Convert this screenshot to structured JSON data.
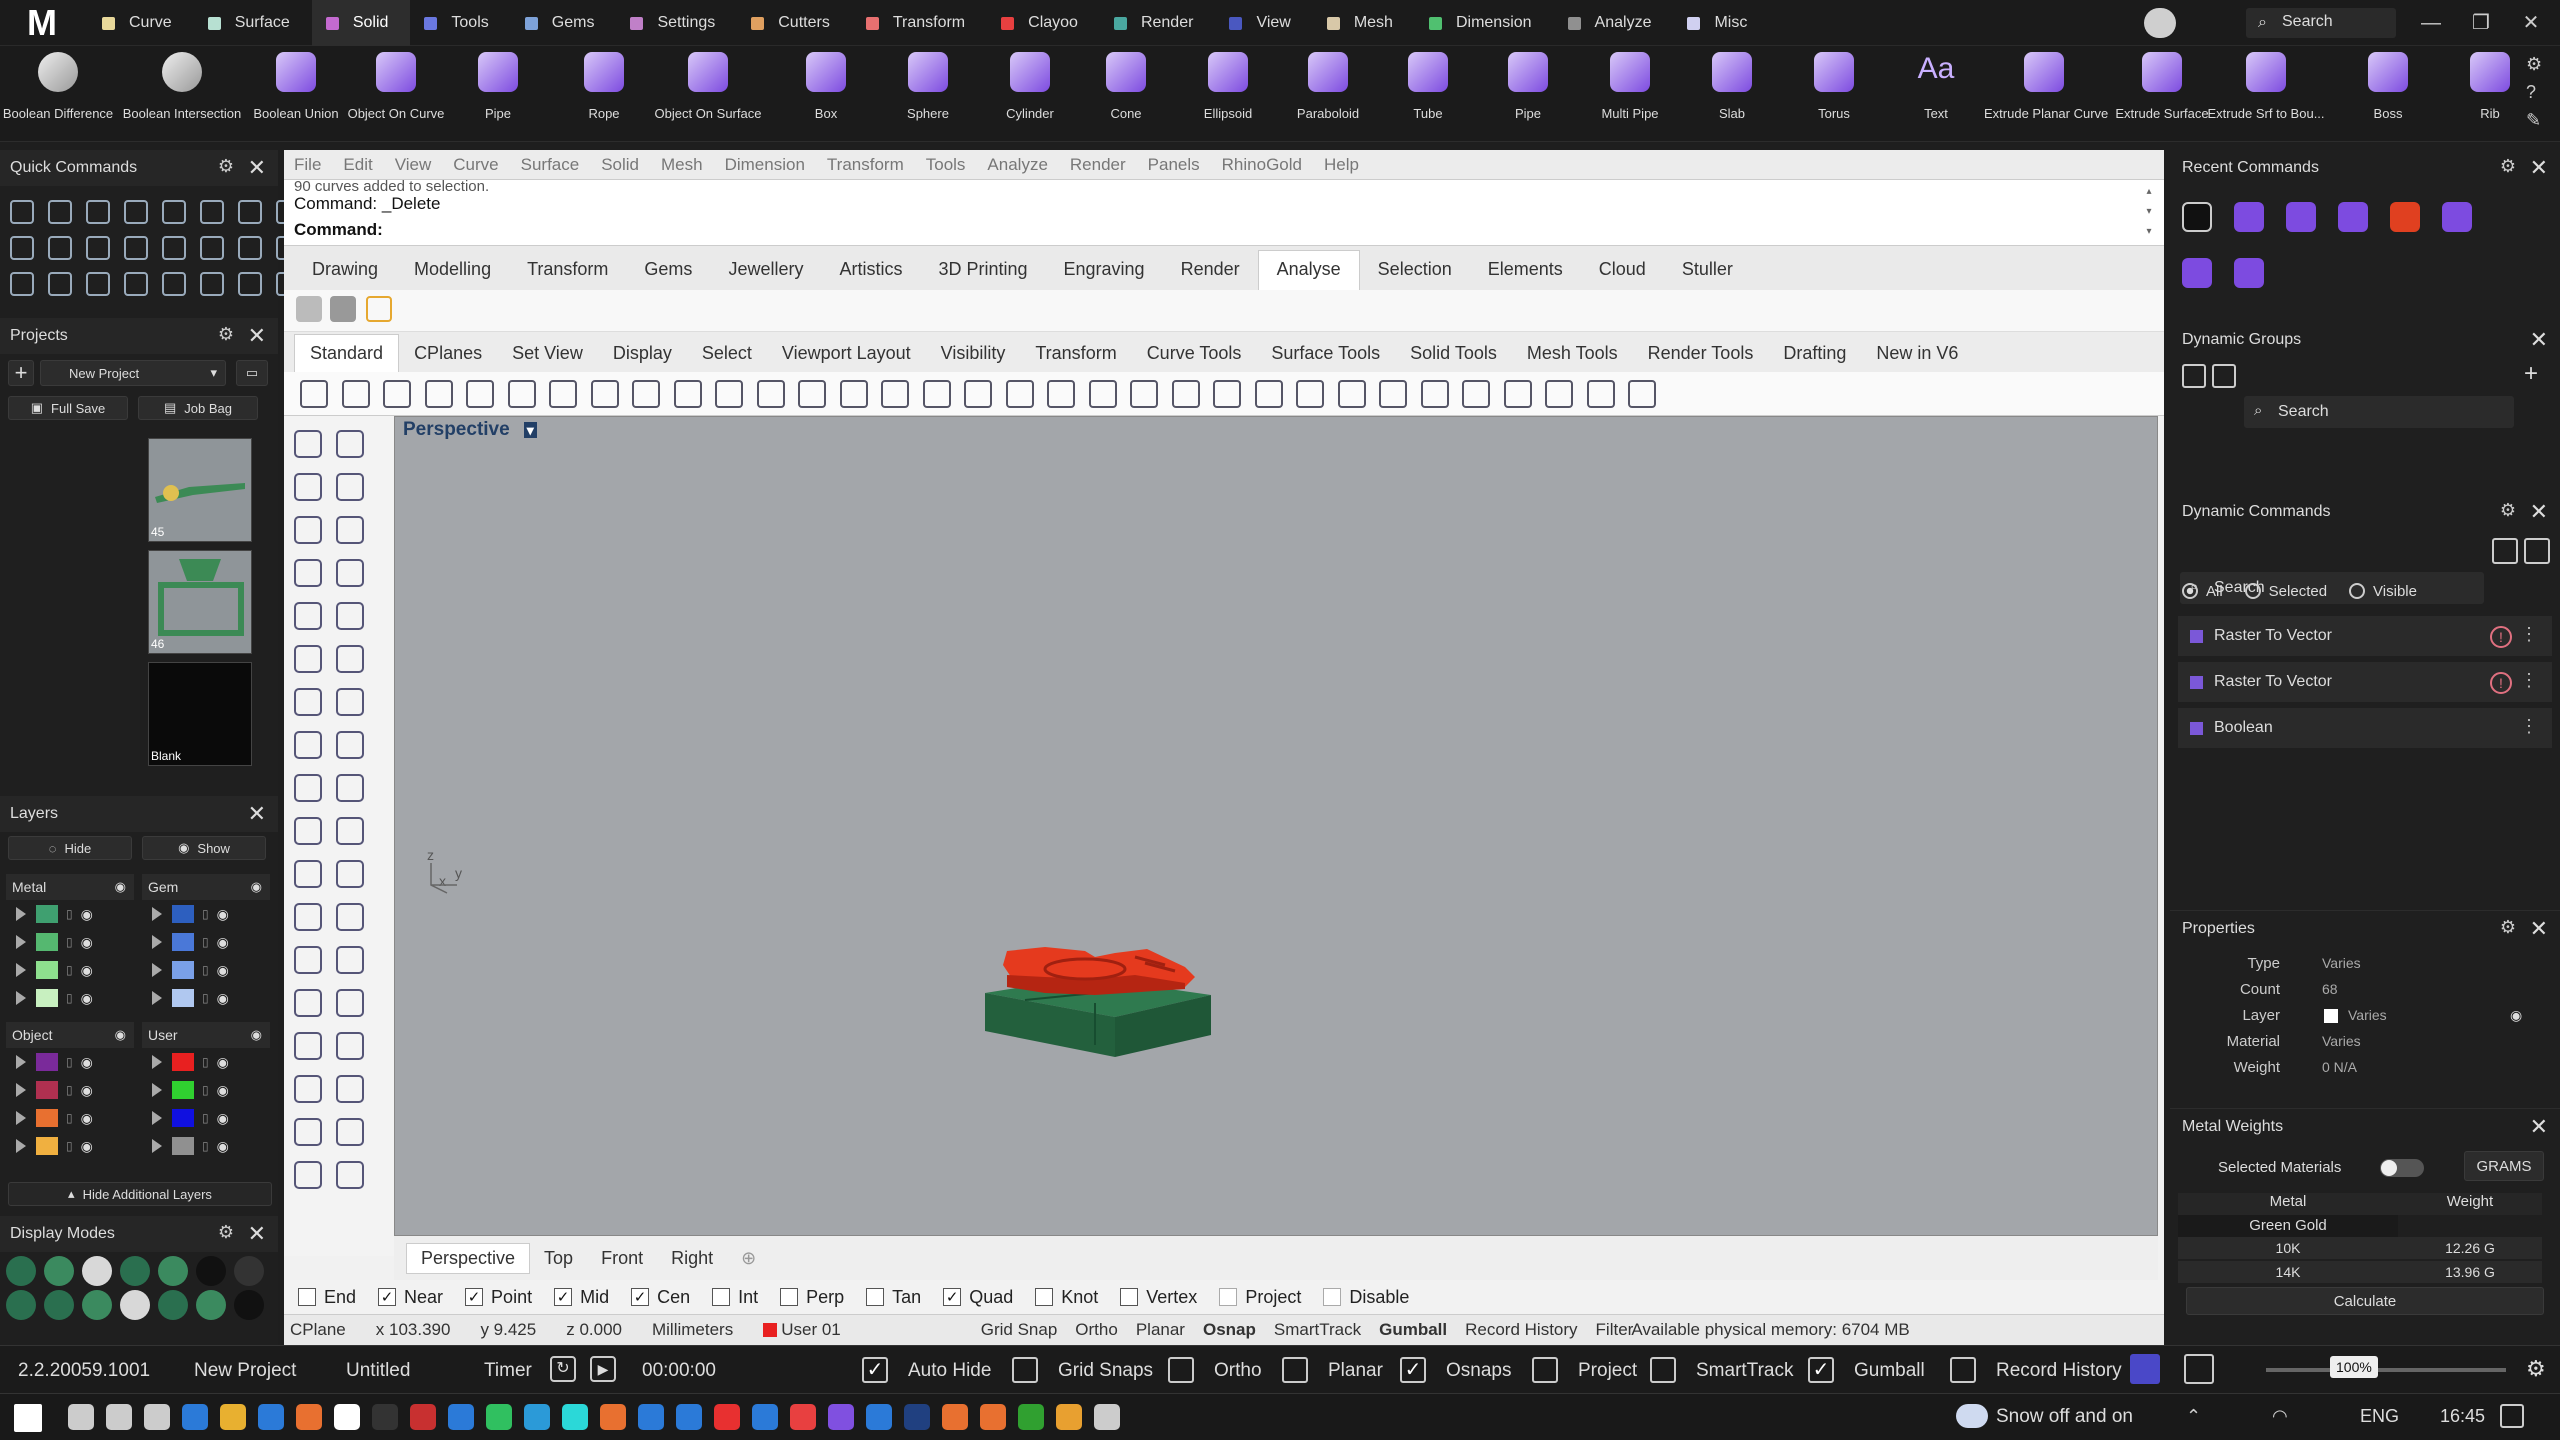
{
  "app": {
    "logo": "M"
  },
  "menu_tabs": [
    {
      "label": "Curve",
      "color": "#e8d89a"
    },
    {
      "label": "Surface",
      "color": "#b7e0d2"
    },
    {
      "label": "Solid",
      "color": "#c46ad0"
    },
    {
      "label": "Tools",
      "color": "#6a78e0"
    },
    {
      "label": "Gems",
      "color": "#7ea2d8"
    },
    {
      "label": "Settings",
      "color": "#c080c8"
    },
    {
      "label": "Cutters",
      "color": "#e0a060"
    },
    {
      "label": "Transform",
      "color": "#e87070"
    },
    {
      "label": "Clayoo",
      "color": "#e84040"
    },
    {
      "label": "Render",
      "color": "#4aa8a0"
    },
    {
      "label": "View",
      "color": "#4a58c0"
    },
    {
      "label": "Mesh",
      "color": "#d8c8a8"
    },
    {
      "label": "Dimension",
      "color": "#50c070"
    },
    {
      "label": "Analyze",
      "color": "#909090"
    },
    {
      "label": "Misc",
      "color": "#d0d0f0"
    }
  ],
  "top_search": {
    "label": "Search"
  },
  "ribbon_tools": [
    "Boolean Difference",
    "Boolean Intersection",
    "Boolean Union",
    "Object On Curve",
    "Pipe",
    "Rope",
    "Object On Surface",
    "Box",
    "Sphere",
    "Cylinder",
    "Cone",
    "Ellipsoid",
    "Paraboloid",
    "Tube",
    "Pipe",
    "Multi Pipe",
    "Slab",
    "Torus",
    "Text",
    "Extrude Planar Curve",
    "Extrude Surface",
    "Extrude Srf to Bou...",
    "Boss",
    "Rib"
  ],
  "text_tool_glyph": "Aa",
  "quick_commands": {
    "title": "Quick Commands"
  },
  "projects": {
    "title": "Projects",
    "project_name": "New Project",
    "full_save": "Full Save",
    "job_bag": "Job Bag",
    "thumbs": [
      {
        "label": "45"
      },
      {
        "label": "46"
      },
      {
        "label": "Blank"
      }
    ]
  },
  "layers": {
    "title": "Layers",
    "hide": "Hide",
    "show": "Show",
    "groups": [
      {
        "name": "Metal",
        "colors": [
          "#3fa070",
          "#55b870",
          "#8ee08e",
          "#c8f0c0"
        ]
      },
      {
        "name": "Gem",
        "colors": [
          "#2d5fbf",
          "#4a78d8",
          "#7aa0e8",
          "#b0c8f0"
        ]
      },
      {
        "name": "Object",
        "colors": [
          "#7a2a9a",
          "#b03050",
          "#e87030",
          "#f0b040"
        ]
      },
      {
        "name": "User",
        "colors": [
          "#e82020",
          "#30d030",
          "#1010e0",
          "#909090"
        ]
      }
    ],
    "hide_additional": "Hide Additional Layers"
  },
  "display_modes": {
    "title": "Display Modes"
  },
  "main_menu": [
    "File",
    "Edit",
    "View",
    "Curve",
    "Surface",
    "Solid",
    "Mesh",
    "Dimension",
    "Transform",
    "Tools",
    "Analyze",
    "Render",
    "Panels",
    "RhinoGold",
    "Help"
  ],
  "command_history": {
    "line1": "90 curves added to selection.",
    "line2": "Command: _Delete",
    "prompt": "Command:"
  },
  "tabs1": [
    "Drawing",
    "Modelling",
    "Transform",
    "Gems",
    "Jewellery",
    "Artistics",
    "3D Printing",
    "Engraving",
    "Render",
    "Analyse",
    "Selection",
    "Elements",
    "Cloud",
    "Stuller"
  ],
  "tabs1_active": "Analyse",
  "tabs2": [
    "Standard",
    "CPlanes",
    "Set View",
    "Display",
    "Select",
    "Viewport Layout",
    "Visibility",
    "Transform",
    "Curve Tools",
    "Surface Tools",
    "Solid Tools",
    "Mesh Tools",
    "Render Tools",
    "Drafting",
    "New in V6"
  ],
  "tabs2_active": "Standard",
  "viewport": {
    "title": "Perspective",
    "axis_z": "z",
    "axis_x": "x",
    "axis_y": "y"
  },
  "viewport_tabs": [
    "Perspective",
    "Top",
    "Front",
    "Right"
  ],
  "osnaps": [
    {
      "label": "End",
      "checked": false
    },
    {
      "label": "Near",
      "checked": true
    },
    {
      "label": "Point",
      "checked": true
    },
    {
      "label": "Mid",
      "checked": true
    },
    {
      "label": "Cen",
      "checked": true
    },
    {
      "label": "Int",
      "checked": false
    },
    {
      "label": "Perp",
      "checked": false
    },
    {
      "label": "Tan",
      "checked": false
    },
    {
      "label": "Quad",
      "checked": true
    },
    {
      "label": "Knot",
      "checked": false
    },
    {
      "label": "Vertex",
      "checked": false
    },
    {
      "label": "Project",
      "checked": false
    },
    {
      "label": "Disable",
      "checked": false
    }
  ],
  "coords": {
    "cplane": "CPlane",
    "x": "x 103.390",
    "y": "y 9.425",
    "z": "z 0.000",
    "units": "Millimeters",
    "layer": "User 01",
    "layer_color": "#e82020"
  },
  "status_toggles": [
    "Grid Snap",
    "Ortho",
    "Planar",
    "Osnap",
    "SmartTrack",
    "Gumball",
    "Record History",
    "Filter"
  ],
  "memory": "Available physical memory: 6704 MB",
  "recent_commands": {
    "title": "Recent Commands"
  },
  "dynamic_groups": {
    "title": "Dynamic Groups",
    "search": "Search"
  },
  "dynamic_commands": {
    "title": "Dynamic Commands",
    "search": "Search",
    "filters": [
      {
        "label": "All",
        "selected": true
      },
      {
        "label": "Selected",
        "selected": false
      },
      {
        "label": "Visible",
        "selected": false
      }
    ],
    "items": [
      {
        "label": "Raster To Vector",
        "warn": true
      },
      {
        "label": "Raster To Vector",
        "warn": true
      },
      {
        "label": "Boolean",
        "warn": false
      }
    ]
  },
  "properties": {
    "title": "Properties",
    "rows": [
      {
        "key": "Type",
        "value": "Varies"
      },
      {
        "key": "Count",
        "value": "68"
      },
      {
        "key": "Layer",
        "value": "Varies"
      },
      {
        "key": "Material",
        "value": "Varies"
      },
      {
        "key": "Weight",
        "value": "0 N/A"
      }
    ]
  },
  "metal_weights": {
    "title": "Metal Weights",
    "selected_materials": "Selected Materials",
    "unit": "GRAMS",
    "col_metal": "Metal",
    "col_weight": "Weight",
    "group": "Green Gold",
    "rows": [
      {
        "metal": "10K",
        "weight": "12.26 G"
      },
      {
        "metal": "14K",
        "weight": "13.96 G"
      }
    ],
    "calculate": "Calculate"
  },
  "statusbar": {
    "version": "2.2.20059.1001",
    "project": "New Project",
    "file": "Untitled",
    "timer": "Timer",
    "time": "00:00:00",
    "toggles": [
      {
        "label": "Auto Hide",
        "checked": true
      },
      {
        "label": "Grid Snaps",
        "checked": false
      },
      {
        "label": "Ortho",
        "checked": false
      },
      {
        "label": "Planar",
        "checked": false
      },
      {
        "label": "Osnaps",
        "checked": true
      },
      {
        "label": "Project",
        "checked": false
      },
      {
        "label": "SmartTrack",
        "checked": false
      },
      {
        "label": "Gumball",
        "checked": true
      },
      {
        "label": "Record History",
        "checked": false
      }
    ],
    "zoom": "100%"
  },
  "taskbar": {
    "weather": "Snow off and on",
    "lang": "ENG",
    "time": "16:45"
  }
}
